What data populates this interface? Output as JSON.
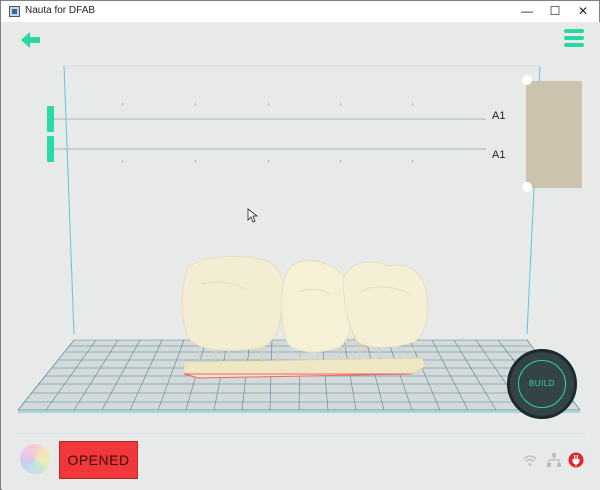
{
  "window": {
    "title": "Nauta for DFAB",
    "controls": {
      "minimize": "—",
      "maximize": "☐",
      "close": "✕"
    }
  },
  "toolbar": {
    "back_icon": "arrow-left-icon",
    "menu_icon": "hamburger-menu-icon"
  },
  "layers": {
    "labels": [
      "A1",
      "A1"
    ]
  },
  "shade_panel": {
    "color": "#cbc3ad"
  },
  "build": {
    "label": "BUILD"
  },
  "bottom_bar": {
    "status_button_label": "OPENED",
    "status_button_color": "#f0373a",
    "icons": [
      "color-wheel-icon",
      "wifi-icon",
      "network-icon",
      "power-plug-icon"
    ]
  },
  "colors": {
    "accent": "#2bd6a5",
    "background": "#e8e9e9",
    "grid": "#5a8d99"
  }
}
